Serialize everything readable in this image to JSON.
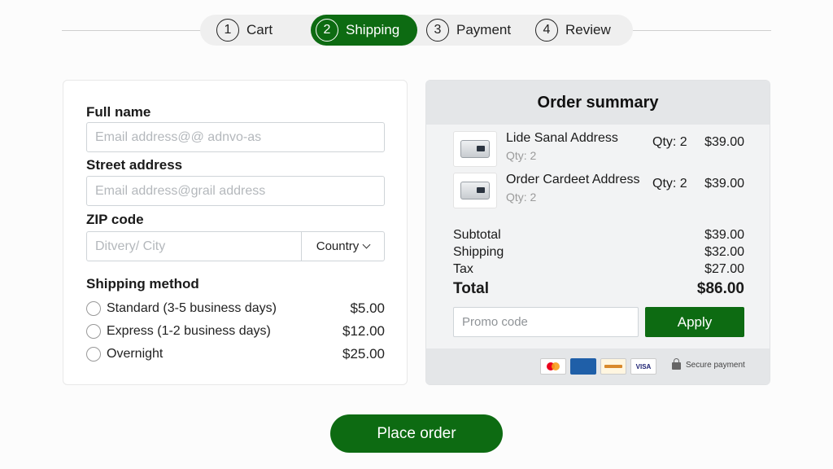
{
  "stepper": {
    "steps": [
      {
        "num": "1",
        "label": "Cart"
      },
      {
        "num": "2",
        "label": "Shipping"
      },
      {
        "num": "3",
        "label": "Payment"
      },
      {
        "num": "4",
        "label": "Review"
      }
    ],
    "active_index": 1
  },
  "form": {
    "full_name_label": "Full name",
    "full_name_placeholder": "Email address@@ adnvo-as",
    "street_label": "Street address",
    "street_placeholder": "Email address@grail address",
    "zip_label": "ZIP code",
    "zip_placeholder": "Ditvery/ City",
    "country_label": "Country",
    "shipping_method_label": "Shipping method",
    "shipping_options": [
      {
        "label": "Standard (3-5 business days)",
        "price": "$5.00"
      },
      {
        "label": "Express (1-2 business days)",
        "price": "$12.00"
      },
      {
        "label": "Overnight",
        "price": "$25.00"
      }
    ]
  },
  "summary": {
    "title": "Order summary",
    "items": [
      {
        "name": "Lide Sanal Address",
        "sub": "Qty: 2",
        "qty": "Qty: 2",
        "price": "$39.00"
      },
      {
        "name": "Order Cardeet Address",
        "sub": "Qty: 2",
        "qty": "Qty: 2",
        "price": "$39.00"
      }
    ],
    "subtotal_label": "Subtotal",
    "subtotal": "$39.00",
    "shipping_label": "Shipping",
    "shipping": "$32.00",
    "tax_label": "Tax",
    "tax": "$27.00",
    "total_label": "Total",
    "total": "$86.00",
    "promo_placeholder": "Promo code",
    "apply_label": "Apply",
    "cards": [
      "mastercard",
      "amex",
      "paypal",
      "visa"
    ],
    "visa_text": "VISA",
    "secure_text": "Secure payment"
  },
  "place_order_label": "Place order",
  "colors": {
    "accent": "#0d6b12"
  }
}
